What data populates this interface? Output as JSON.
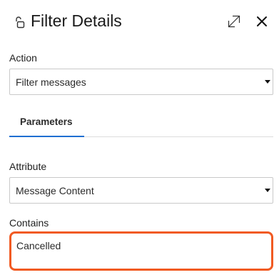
{
  "header": {
    "title": "Filter Details",
    "icons": {
      "lock": "unlock-icon",
      "expand": "expand-icon",
      "close": "close-icon"
    }
  },
  "action": {
    "label": "Action",
    "selected": "Filter messages"
  },
  "tabs": [
    {
      "label": "Parameters",
      "active": true
    }
  ],
  "attribute": {
    "label": "Attribute",
    "selected": "Message Content"
  },
  "contains": {
    "label": "Contains",
    "value": "Cancelled"
  },
  "colors": {
    "accent_tab": "#1f6fd1",
    "highlight_border": "#f15a22"
  }
}
